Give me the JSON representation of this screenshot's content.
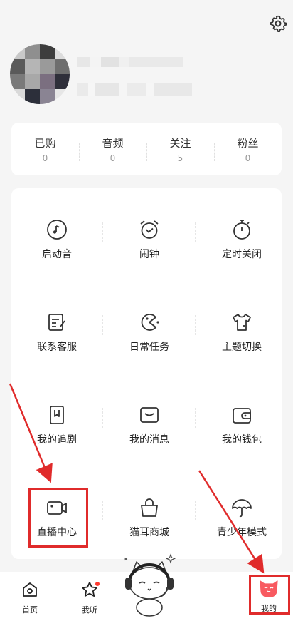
{
  "profile": {},
  "stats": [
    {
      "label": "已购",
      "value": "0"
    },
    {
      "label": "音频",
      "value": "0"
    },
    {
      "label": "关注",
      "value": "5"
    },
    {
      "label": "粉丝",
      "value": "0"
    }
  ],
  "grid": [
    {
      "label": "启动音",
      "icon": "music-disc-icon"
    },
    {
      "label": "闹钟",
      "icon": "alarm-clock-icon"
    },
    {
      "label": "定时关闭",
      "icon": "timer-icon"
    },
    {
      "label": "联系客服",
      "icon": "edit-note-icon"
    },
    {
      "label": "日常任务",
      "icon": "pacman-task-icon"
    },
    {
      "label": "主题切换",
      "icon": "tshirt-icon"
    },
    {
      "label": "我的追剧",
      "icon": "bookmark-icon"
    },
    {
      "label": "我的消息",
      "icon": "message-icon"
    },
    {
      "label": "我的钱包",
      "icon": "wallet-icon"
    },
    {
      "label": "直播中心",
      "icon": "video-camera-icon"
    },
    {
      "label": "猫耳商城",
      "icon": "shopping-bag-icon"
    },
    {
      "label": "青少年模式",
      "icon": "umbrella-icon"
    }
  ],
  "tabbar": {
    "home": "首页",
    "listen": "我听",
    "mine": "我的"
  },
  "colors": {
    "accent": "#f85a60",
    "annotation": "#e02b2b"
  }
}
